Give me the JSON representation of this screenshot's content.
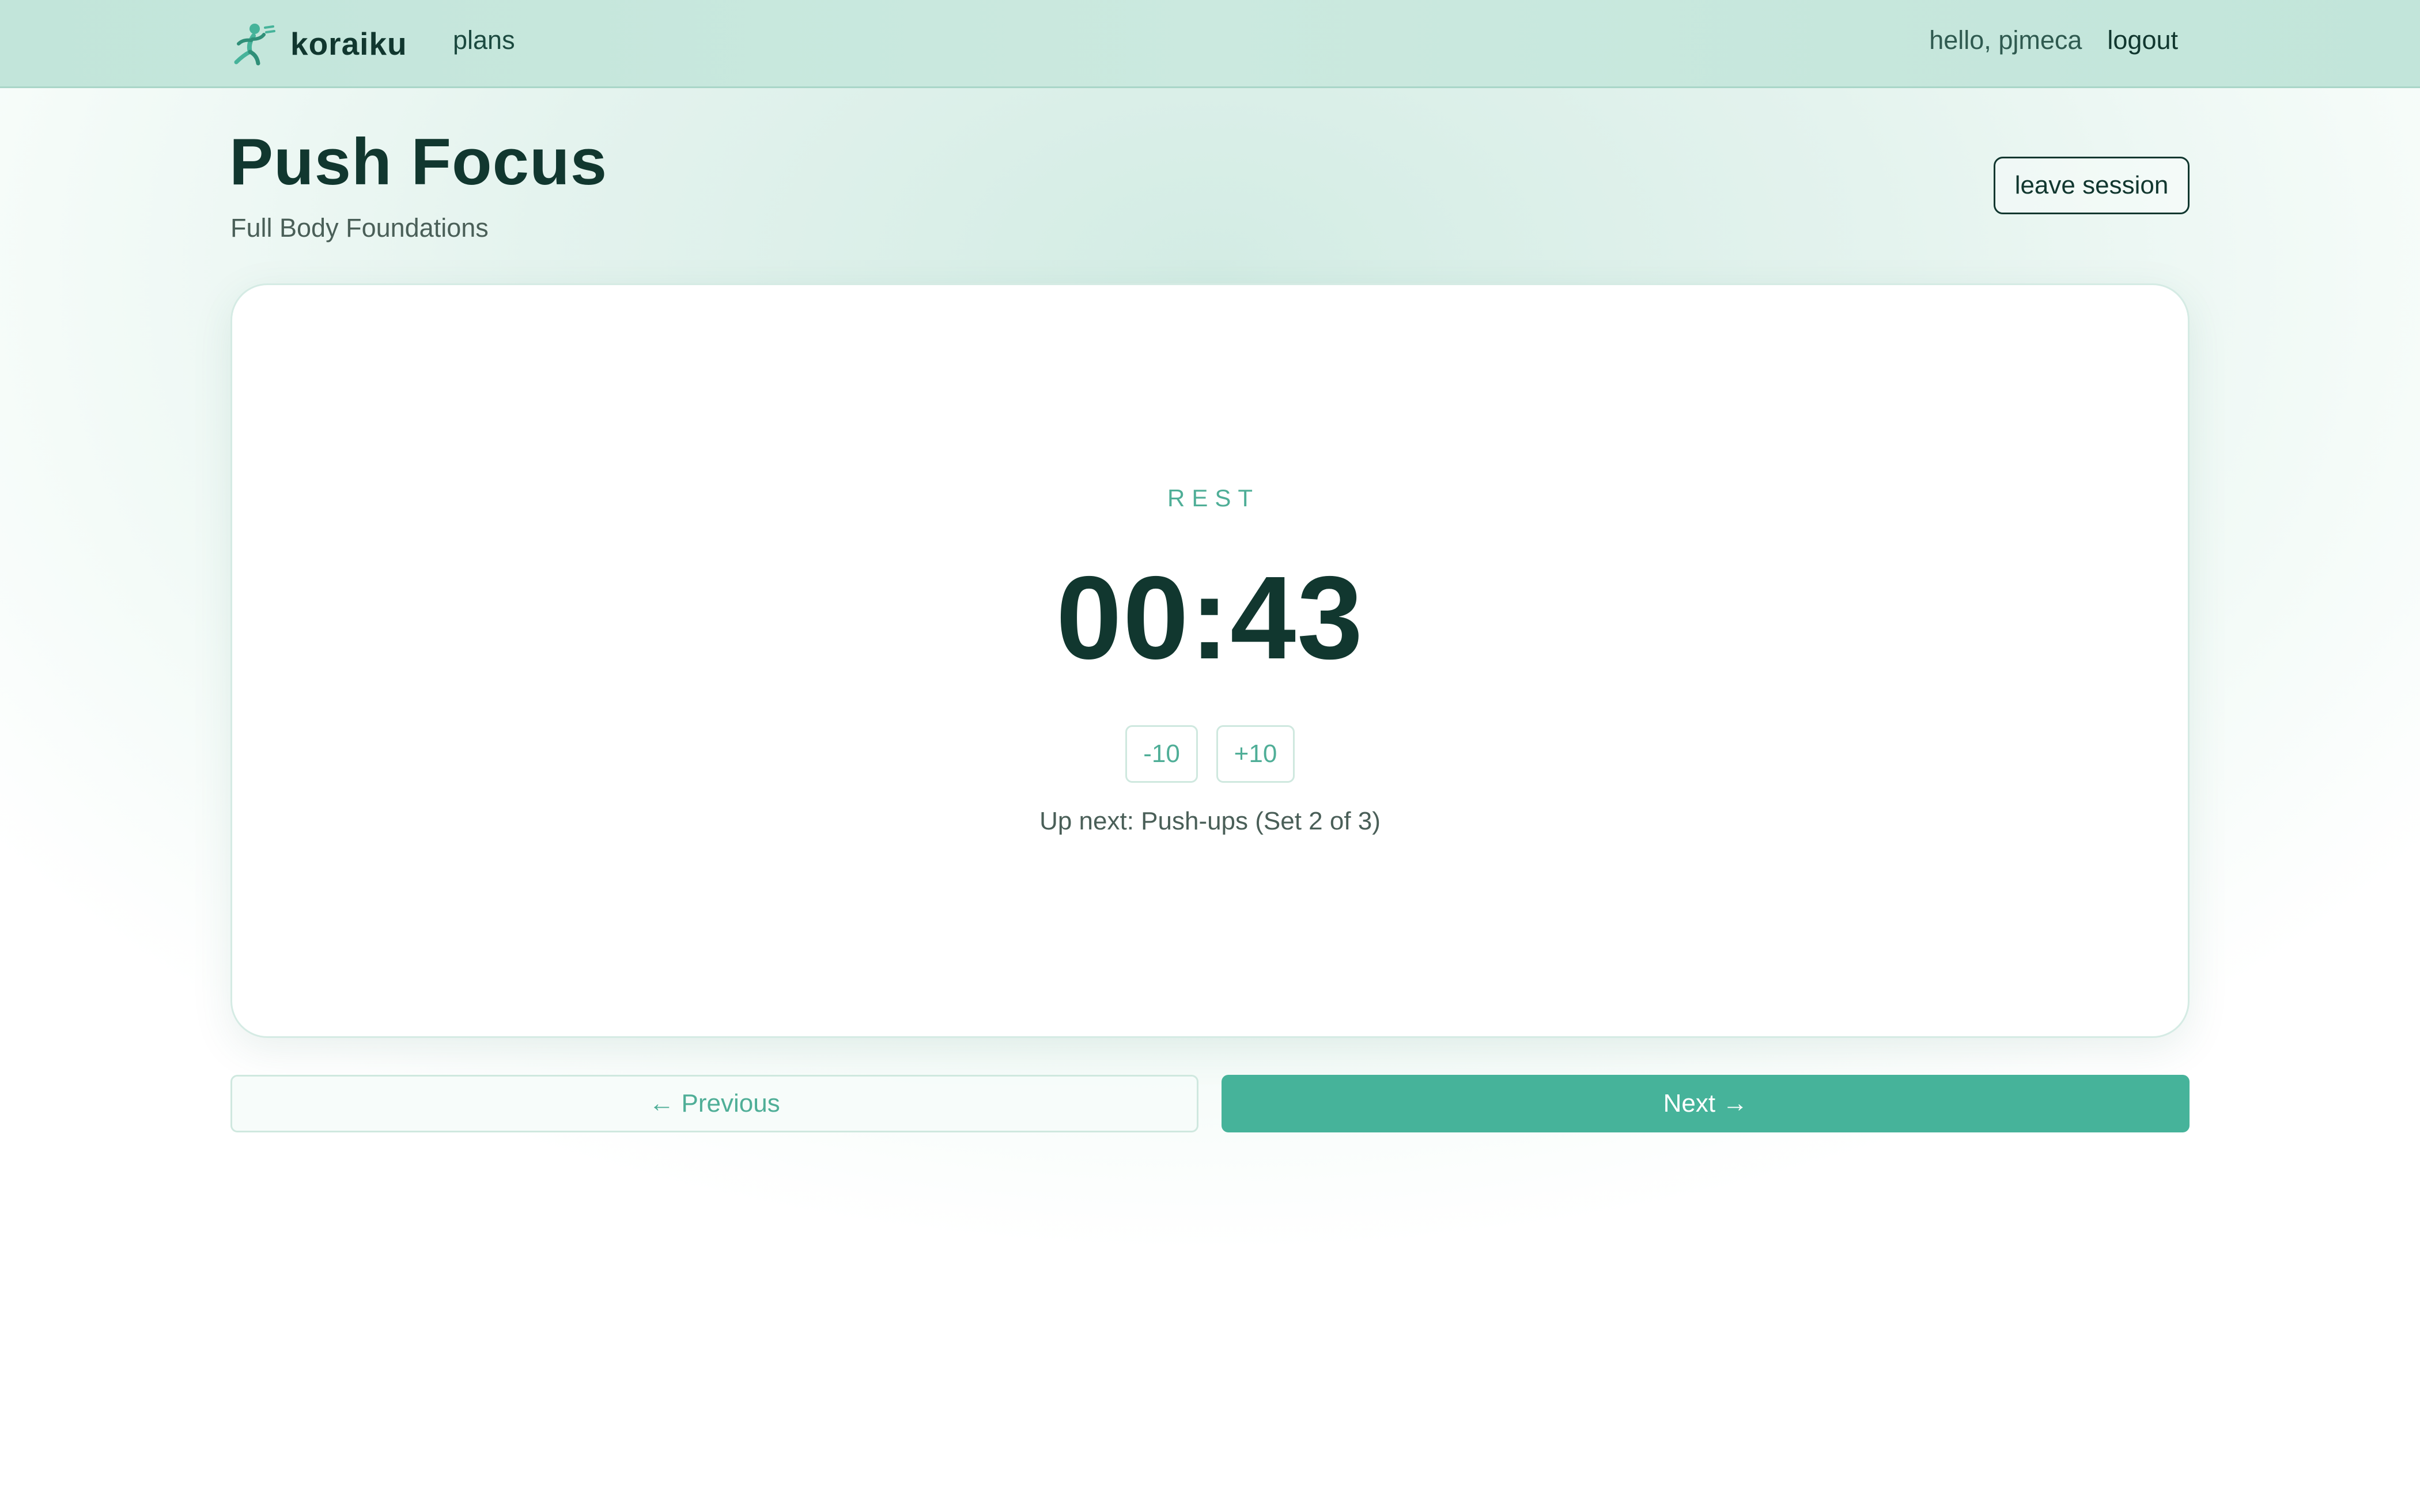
{
  "topbar": {
    "brand_name": "koraiku",
    "brand_icon": "running-figure-icon",
    "nav_plans": "plans",
    "greeting": "hello, pjmeca",
    "logout": "logout"
  },
  "header": {
    "title": "Push Focus",
    "subtitle": "Full Body Foundations",
    "leave_label": "leave session"
  },
  "timer_card": {
    "phase": "REST",
    "time": "00:43",
    "minus_label": "-10",
    "plus_label": "+10",
    "up_next": "Up next: Push-ups (Set 2 of 3)"
  },
  "navigation": {
    "previous_label": "← Previous",
    "next_label": "Next →"
  },
  "colors": {
    "accent": "#46b39a",
    "dark_text": "#11372f",
    "topbar_bg": "#c2e5da"
  }
}
